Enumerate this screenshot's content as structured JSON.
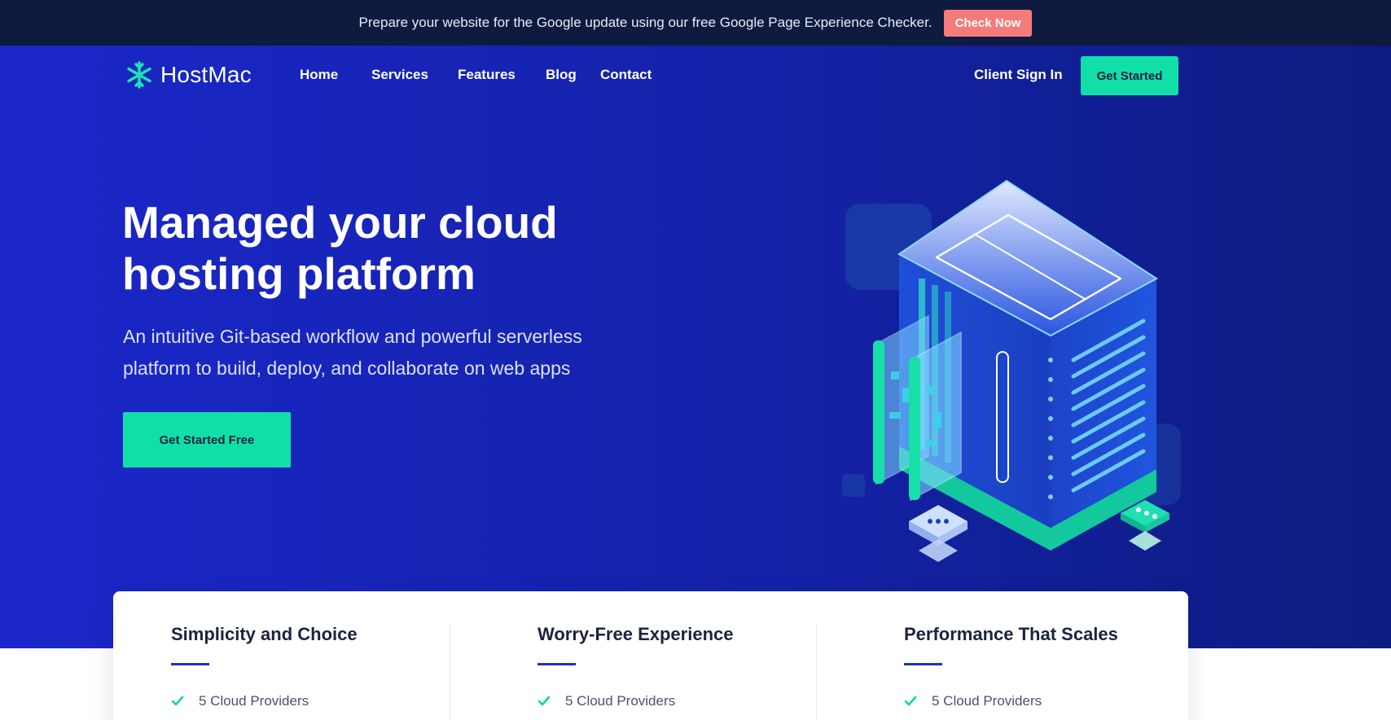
{
  "announcement": {
    "text": "Prepare your website for the Google update using our free Google Page Experience Checker.",
    "button_label": "Check Now"
  },
  "nav": {
    "brand": "HostMac",
    "items": [
      {
        "label": "Home"
      },
      {
        "label": "Services"
      },
      {
        "label": "Features"
      },
      {
        "label": "Blog"
      },
      {
        "label": "Contact"
      }
    ],
    "signin_label": "Client Sign In",
    "cta_label": "Get Started"
  },
  "hero": {
    "headline_line1": "Managed your cloud",
    "headline_line2": "hosting platform",
    "subtext_line1": "An intuitive Git-based workflow and powerful serverless",
    "subtext_line2": "platform to build, deploy, and collaborate on web apps",
    "cta_label": "Get Started Free"
  },
  "features": [
    {
      "title": "Simplicity and Choice",
      "item": "5 Cloud Providers"
    },
    {
      "title": "Worry-Free Experience",
      "item": "5 Cloud Providers"
    },
    {
      "title": "Performance That Scales",
      "item": "5 Cloud Providers"
    }
  ],
  "colors": {
    "accent": "#10e0a8",
    "hero_bg": "#1b27c9",
    "topbar_bg": "#0f1a3f",
    "alert_button": "#f57b7b",
    "underline": "#2030c8"
  },
  "icons": [
    "snowflake-logo-icon",
    "check-icon",
    "server-illustration"
  ]
}
